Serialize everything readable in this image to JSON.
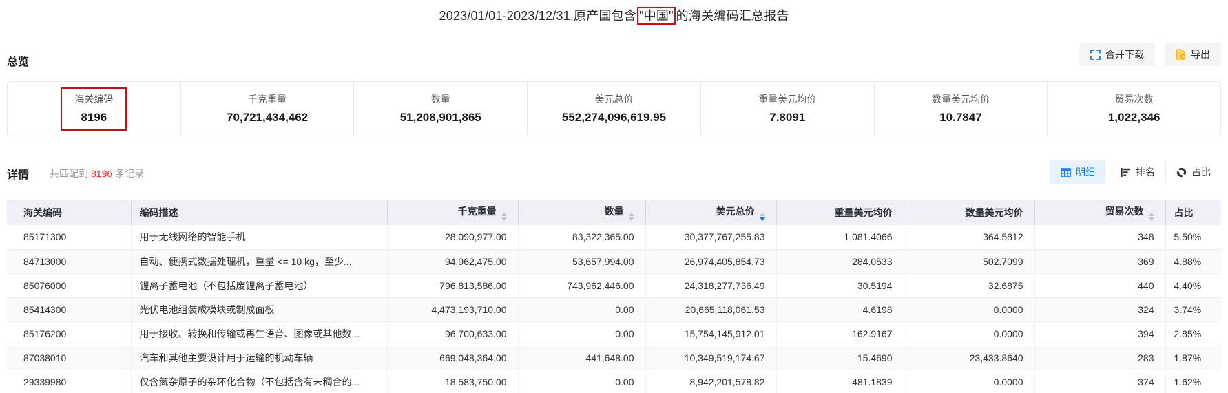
{
  "title": {
    "prefix": "2023/01/01-2023/12/31,原产国包含",
    "highlight": "\"中国\"",
    "suffix": "的海关编码汇总报告"
  },
  "toolbar": {
    "merge_download_label": "合并下载",
    "export_label": "导出",
    "merge_icon": "merge-cells-icon",
    "export_icon": "export-file-icon"
  },
  "overview": {
    "heading": "总览",
    "stats": [
      {
        "key": "hs-code",
        "label": "海关编码",
        "value": "8196",
        "highlighted": true
      },
      {
        "key": "weight-kg",
        "label": "千克重量",
        "value": "70,721,434,462",
        "highlighted": false
      },
      {
        "key": "quantity",
        "label": "数量",
        "value": "51,208,901,865",
        "highlighted": false
      },
      {
        "key": "usd-total",
        "label": "美元总价",
        "value": "552,274,096,619.95",
        "highlighted": false
      },
      {
        "key": "usd-per-kg",
        "label": "重量美元均价",
        "value": "7.8091",
        "highlighted": false
      },
      {
        "key": "usd-per-qty",
        "label": "数量美元均价",
        "value": "10.7847",
        "highlighted": false
      },
      {
        "key": "trade-count",
        "label": "贸易次数",
        "value": "1,022,346",
        "highlighted": false
      }
    ]
  },
  "detail": {
    "heading": "详情",
    "match_prefix": "共匹配到",
    "match_count": "8196",
    "match_suffix": "条记录",
    "views": [
      {
        "key": "detail",
        "label": "明细",
        "active": true,
        "icon": "table-icon"
      },
      {
        "key": "ranking",
        "label": "排名",
        "active": false,
        "icon": "ranking-bars-icon"
      },
      {
        "key": "share",
        "label": "占比",
        "active": false,
        "icon": "donut-chart-icon"
      }
    ]
  },
  "table": {
    "columns": [
      {
        "key": "code",
        "label": "海关编码",
        "align": "left",
        "sortable": false,
        "sort": null
      },
      {
        "key": "description",
        "label": "编码描述",
        "align": "left",
        "sortable": false,
        "sort": null
      },
      {
        "key": "weight-kg",
        "label": "千克重量",
        "align": "right",
        "sortable": true,
        "sort": null
      },
      {
        "key": "quantity",
        "label": "数量",
        "align": "right",
        "sortable": true,
        "sort": null
      },
      {
        "key": "usd-total",
        "label": "美元总价",
        "align": "right",
        "sortable": true,
        "sort": "desc"
      },
      {
        "key": "usd-per-kg",
        "label": "重量美元均价",
        "align": "right",
        "sortable": false,
        "sort": null
      },
      {
        "key": "usd-per-qty",
        "label": "数量美元均价",
        "align": "right",
        "sortable": false,
        "sort": null
      },
      {
        "key": "trade-count",
        "label": "贸易次数",
        "align": "right",
        "sortable": true,
        "sort": null
      },
      {
        "key": "share",
        "label": "占比",
        "align": "left",
        "sortable": false,
        "sort": null
      }
    ],
    "rows": [
      [
        "85171300",
        "用于无线网络的智能手机",
        "28,090,977.00",
        "83,322,365.00",
        "30,377,767,255.83",
        "1,081.4066",
        "364.5812",
        "348",
        "5.50%"
      ],
      [
        "84713000",
        "自动、便携式数据处理机，重量 <= 10 kg，至少...",
        "94,962,475.00",
        "53,657,994.00",
        "26,974,405,854.73",
        "284.0533",
        "502.7099",
        "369",
        "4.88%"
      ],
      [
        "85076000",
        "锂离子蓄电池（不包括废锂离子蓄电池）",
        "796,813,586.00",
        "743,962,446.00",
        "24,318,277,736.49",
        "30.5194",
        "32.6875",
        "440",
        "4.40%"
      ],
      [
        "85414300",
        "光伏电池组装成模块或制成面板",
        "4,473,193,710.00",
        "0.00",
        "20,665,118,061.53",
        "4.6198",
        "0.0000",
        "324",
        "3.74%"
      ],
      [
        "85176200",
        "用于接收、转换和传输或再生语音、图像或其他数...",
        "96,700,633.00",
        "0.00",
        "15,754,145,912.01",
        "162.9167",
        "0.0000",
        "394",
        "2.85%"
      ],
      [
        "87038010",
        "汽车和其他主要设计用于运输的机动车辆",
        "669,048,364.00",
        "441,648.00",
        "10,349,519,174.67",
        "15.4690",
        "23,433.8640",
        "283",
        "1.87%"
      ],
      [
        "29339980",
        "仅含氮杂原子的杂环化合物（不包括含有未稠合的...",
        "18,583,750.00",
        "0.00",
        "8,942,201,578.82",
        "481.1839",
        "0.0000",
        "374",
        "1.62%"
      ]
    ]
  },
  "colors": {
    "accent_blue": "#1677ff",
    "annotation_red": "#e60012",
    "count_red": "#f5222d",
    "export_orange": "#faad14",
    "header_bg": "#eef0f6"
  }
}
